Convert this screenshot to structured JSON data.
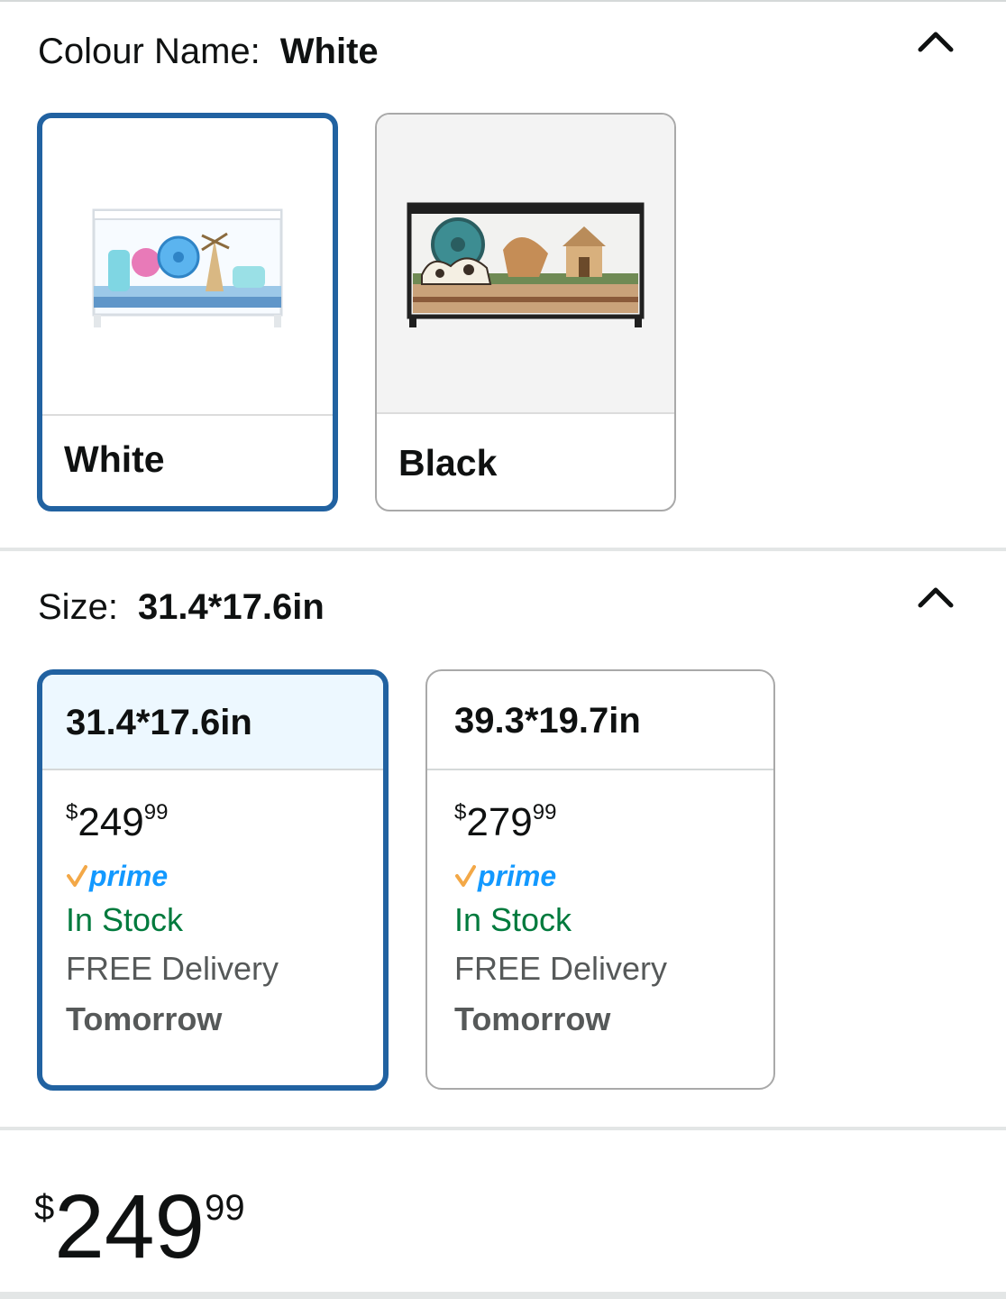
{
  "colour": {
    "label": "Colour Name:",
    "selected": "White",
    "options": [
      {
        "label": "White",
        "selected": true,
        "image": "white-hamster-cage-image"
      },
      {
        "label": "Black",
        "selected": false,
        "image": "black-hamster-cage-image"
      }
    ],
    "collapse_icon": "chevron-up-icon"
  },
  "size": {
    "label": "Size:",
    "selected": "31.4*17.6in",
    "options": [
      {
        "label": "31.4*17.6in",
        "selected": true,
        "price": {
          "symbol": "$",
          "whole": "249",
          "fraction": "99"
        },
        "prime": "prime",
        "stock": "In Stock",
        "delivery": "FREE Delivery",
        "delivery_day": "Tomorrow"
      },
      {
        "label": "39.3*19.7in",
        "selected": false,
        "price": {
          "symbol": "$",
          "whole": "279",
          "fraction": "99"
        },
        "prime": "prime",
        "stock": "In Stock",
        "delivery": "FREE Delivery",
        "delivery_day": "Tomorrow"
      }
    ],
    "collapse_icon": "chevron-up-icon"
  },
  "total_price": {
    "symbol": "$",
    "whole": "249",
    "fraction": "99"
  },
  "colors": {
    "selected_border": "#2162a1",
    "selected_head": "#edf8ff",
    "prime_blue": "#1399ff",
    "prime_check": "#f3a847",
    "stock_green": "#007a3d",
    "muted": "#565959"
  }
}
